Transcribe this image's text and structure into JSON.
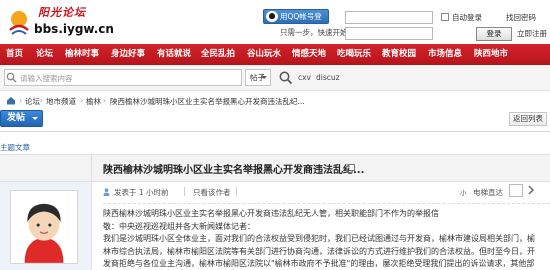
{
  "site": {
    "logo_text": "阳光论坛",
    "logo_url": "bbs.iygw.cn"
  },
  "login": {
    "qq_button": "用QQ帐号登录",
    "qq_sub": "只需一步，快速开始",
    "username_value": "",
    "password_value": "",
    "auto_login": "自动登录",
    "forgot": "找回密码",
    "login_button": "登录",
    "register": "立即注册"
  },
  "nav": [
    "首页",
    "论坛",
    "榆林时事",
    "身边好事",
    "有话就说",
    "全民乱拍",
    "谷山玩水",
    "情感天地",
    "吃喝玩乐",
    "教育校园",
    "市场信息",
    "陕西地市"
  ],
  "search": {
    "placeholder": "请输入搜索内容",
    "type": "帖子",
    "hot_words": [
      "cxv",
      "discuz"
    ]
  },
  "breadcrumb": [
    "论坛",
    "地市频道",
    "榆林",
    "陕西榆林沙城明珠小区业主实名举报黑心开发商违法乱纪..."
  ],
  "toolbar": {
    "post_button": "发帖",
    "back_button": "返回列表",
    "thread_tools": "主题文章"
  },
  "thread": {
    "title": "陕西榆林沙城明珠小区业主实名举报黑心开发商违法乱纪..."
  },
  "meta": {
    "posted": "发表于 1 小时前",
    "author_only": "只看该作者",
    "font_small": "小",
    "mode": "电梯直达"
  },
  "body_lines": [
    "陕西榆林沙城明珠小区业主实名举报黑心开发商违法乱纪无人管，相关职能部门不作为的举报信",
    "敬：中央巡视巡视组并各大新闻媒体记者：",
    "我们是沙城明珠小区全体业主，面对我们的合法权益受到侵犯时，我们已经试图通过与开发商，榆林市建设局相关部门，榆",
    "林市综合执法局，榆林市榆阳区法院等有关部门进行协商沟通，法律诉讼的方式进行维护我们的合法权益。但时至今日，开",
    "发商拒绝与各位业主沟通，榆林市榆阳区法院以\"榆林市政府不予批准\"的理由，屡次拒绝受理我们提出的诉讼请求，其他部"
  ],
  "colors": {
    "nav_red": "#c8171f",
    "link_blue": "#2a62a8",
    "post_blue": "#2d70c0"
  }
}
